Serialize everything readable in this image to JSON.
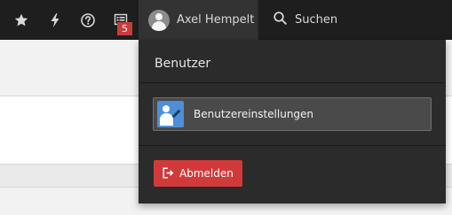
{
  "toolbar": {
    "icons": {
      "bookmarks": "star-icon",
      "flush_cache": "lightning-icon",
      "help": "help-icon",
      "system_info": "system-info-icon"
    },
    "system_info_badge": "5",
    "user": {
      "name": "Axel Hempelt",
      "avatar_icon": "user-avatar-icon"
    },
    "search": {
      "label": "Suchen",
      "icon": "search-icon"
    }
  },
  "user_dropdown": {
    "title": "Benutzer",
    "items": [
      {
        "label": "Benutzereinstellungen",
        "icon": "user-settings-icon"
      }
    ],
    "logout": {
      "label": "Abmelden",
      "icon": "logout-icon"
    }
  },
  "colors": {
    "toolbar_bg": "#1e1e1e",
    "dropdown_bg": "#2b2b2b",
    "badge_bg": "#c83c3c",
    "settings_icon_bg": "#4d8fd8",
    "logout_bg": "#d13a3a"
  }
}
